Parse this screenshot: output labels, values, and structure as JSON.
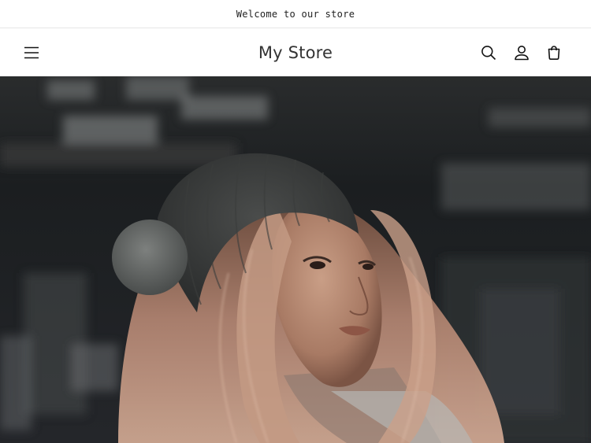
{
  "announcement": {
    "text": "Welcome to our store"
  },
  "header": {
    "logo": "My Store",
    "icons": {
      "menu": "hamburger-menu-icon",
      "search": "search-icon",
      "account": "user-icon",
      "cart": "shopping-bag-icon"
    }
  },
  "hero": {
    "image": "woman-in-beanie-photo"
  },
  "colors": {
    "text": "#121212",
    "background": "#ffffff",
    "divider": "#e6e6e6"
  }
}
